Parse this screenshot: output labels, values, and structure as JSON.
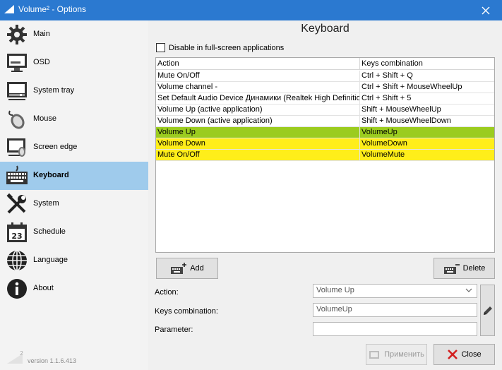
{
  "window": {
    "title": "Volume² - Options",
    "close_icon": "close-icon"
  },
  "sidebar": {
    "items": [
      {
        "label": "Main",
        "icon": "gear-icon"
      },
      {
        "label": "OSD",
        "icon": "monitor-icon"
      },
      {
        "label": "System tray",
        "icon": "system-tray-icon"
      },
      {
        "label": "Mouse",
        "icon": "mouse-icon"
      },
      {
        "label": "Screen edge",
        "icon": "screen-edge-icon"
      },
      {
        "label": "Keyboard",
        "icon": "keyboard-icon",
        "active": true
      },
      {
        "label": "System",
        "icon": "tools-icon"
      },
      {
        "label": "Schedule",
        "icon": "calendar-icon",
        "day": "23"
      },
      {
        "label": "Language",
        "icon": "globe-icon"
      },
      {
        "label": "About",
        "icon": "info-icon"
      }
    ],
    "version": "version 1.1.6.413",
    "version_mark": "2"
  },
  "main": {
    "heading": "Keyboard",
    "fullscreen_checkbox": {
      "label": "Disable in full-screen applications",
      "checked": false
    },
    "table": {
      "columns": [
        "Action",
        "Keys combination"
      ],
      "rows": [
        {
          "action": "Mute On/Off",
          "keys": "Ctrl + Shift + Q"
        },
        {
          "action": "Volume channel -",
          "keys": "Ctrl + Shift + MouseWheelUp"
        },
        {
          "action": "Set Default Audio Device Динамики (Realtek High Definition Audio)",
          "keys": "Ctrl + Shift + 5"
        },
        {
          "action": "Volume Up (active application)",
          "keys": "Shift + MouseWheelUp"
        },
        {
          "action": "Volume Down (active application)",
          "keys": "Shift + MouseWheelDown"
        },
        {
          "action": "Volume Up",
          "keys": "VolumeUp",
          "highlight": "selected"
        },
        {
          "action": "Volume Down",
          "keys": "VolumeDown",
          "highlight": "marker"
        },
        {
          "action": "Mute On/Off",
          "keys": "VolumeMute",
          "highlight": "marker"
        }
      ]
    },
    "add_button": "Add",
    "delete_button": "Delete",
    "form": {
      "action_label": "Action:",
      "action_value": "Volume Up",
      "keys_label": "Keys combination:",
      "keys_value": "VolumeUp",
      "parameter_label": "Parameter:",
      "parameter_value": ""
    },
    "apply_button": "Применить",
    "close_button": "Close"
  },
  "colors": {
    "titlebar": "#2b79d0",
    "active_item": "#9fcbec",
    "selected_row": "#9bcc1f",
    "marker": "#ffee1a",
    "close_x": "#d32020"
  }
}
